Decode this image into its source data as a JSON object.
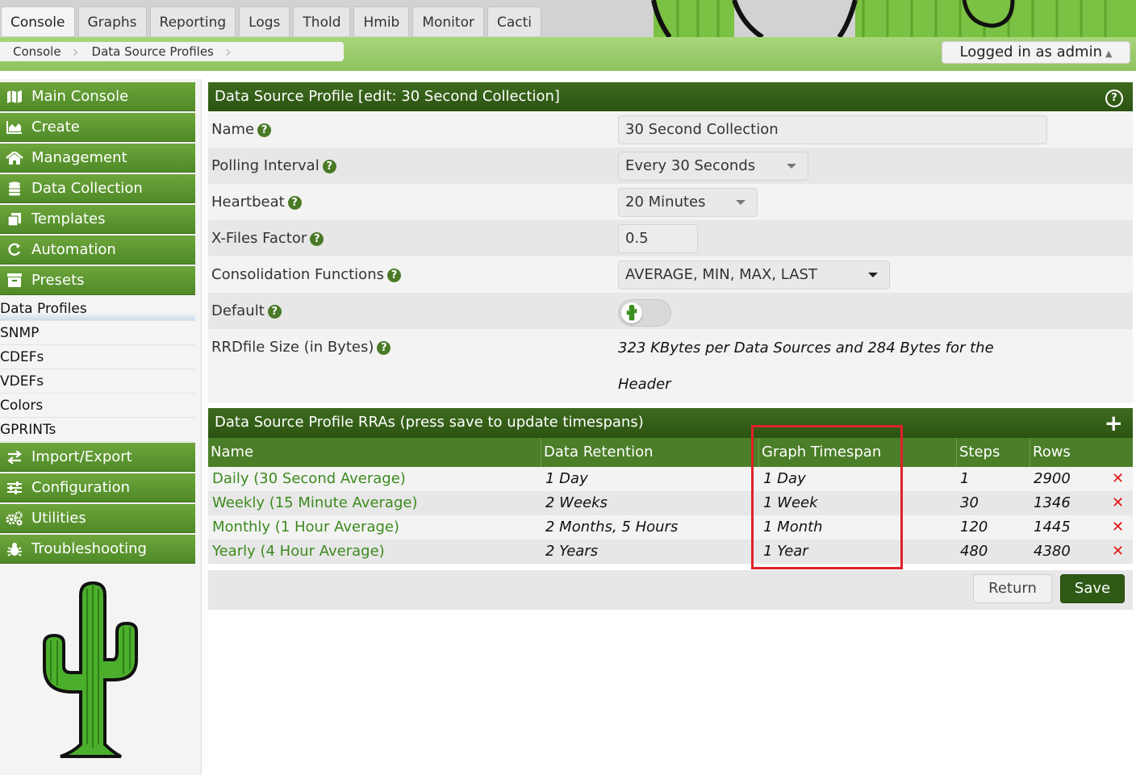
{
  "tabs": [
    {
      "label": "Console",
      "selected": true
    },
    {
      "label": "Graphs"
    },
    {
      "label": "Reporting"
    },
    {
      "label": "Logs"
    },
    {
      "label": "Thold"
    },
    {
      "label": "Hmib"
    },
    {
      "label": "Monitor"
    },
    {
      "label": "Cacti"
    }
  ],
  "breadcrumb": [
    "Console",
    "Data Source Profiles"
  ],
  "user": {
    "login_label": "Logged in as admin"
  },
  "sidebar": {
    "menu": [
      {
        "label": "Main Console",
        "icon": "map-icon"
      },
      {
        "label": "Create",
        "icon": "area-chart-icon"
      },
      {
        "label": "Management",
        "icon": "home-icon"
      },
      {
        "label": "Data Collection",
        "icon": "database-icon"
      },
      {
        "label": "Templates",
        "icon": "copy-icon"
      },
      {
        "label": "Automation",
        "icon": "refresh-icon"
      },
      {
        "label": "Presets",
        "icon": "archive-icon"
      }
    ],
    "presets_items": [
      "Data Profiles",
      "SNMP",
      "CDEFs",
      "VDEFs",
      "Colors",
      "GPRINTs"
    ],
    "menu_after": [
      {
        "label": "Import/Export",
        "icon": "exchange-icon"
      },
      {
        "label": "Configuration",
        "icon": "sliders-icon"
      },
      {
        "label": "Utilities",
        "icon": "cogs-icon"
      },
      {
        "label": "Troubleshooting",
        "icon": "bug-icon"
      }
    ]
  },
  "profile": {
    "title": "Data Source Profile [edit: 30 Second Collection]",
    "fields": {
      "name": {
        "label": "Name",
        "value": "30 Second Collection"
      },
      "polling_interval": {
        "label": "Polling Interval",
        "value": "Every 30 Seconds"
      },
      "heartbeat": {
        "label": "Heartbeat",
        "value": "20 Minutes"
      },
      "xff": {
        "label": "X-Files Factor",
        "value": "0.5"
      },
      "consolidation": {
        "label": "Consolidation Functions",
        "value": "AVERAGE, MIN, MAX, LAST"
      },
      "default": {
        "label": "Default",
        "value": false
      },
      "rrd_size": {
        "label": "RRDfile Size (in Bytes)",
        "value_line1": "323 KBytes per Data Sources and 284 Bytes for the",
        "value_line2": "Header"
      }
    }
  },
  "rras": {
    "title": "Data Source Profile RRAs (press save to update timespans)",
    "columns": [
      "Name",
      "Data Retention",
      "Graph Timespan",
      "Steps",
      "Rows"
    ],
    "rows": [
      {
        "name": "Daily (30 Second Average)",
        "retention": "1 Day",
        "timespan": "1 Day",
        "steps": "1",
        "rows": "2900"
      },
      {
        "name": "Weekly (15 Minute Average)",
        "retention": "2 Weeks",
        "timespan": "1 Week",
        "steps": "30",
        "rows": "1346"
      },
      {
        "name": "Monthly (1 Hour Average)",
        "retention": "2 Months, 5 Hours",
        "timespan": "1 Month",
        "steps": "120",
        "rows": "1445"
      },
      {
        "name": "Yearly (4 Hour Average)",
        "retention": "2 Years",
        "timespan": "1 Year",
        "steps": "480",
        "rows": "4380"
      }
    ]
  },
  "buttons": {
    "return": "Return",
    "save": "Save"
  },
  "colors": {
    "accent": "#4b7e28",
    "header": "#2f5a16",
    "highlight": "#e0202a",
    "link": "#3c8a1e",
    "delete": "#e01010"
  }
}
